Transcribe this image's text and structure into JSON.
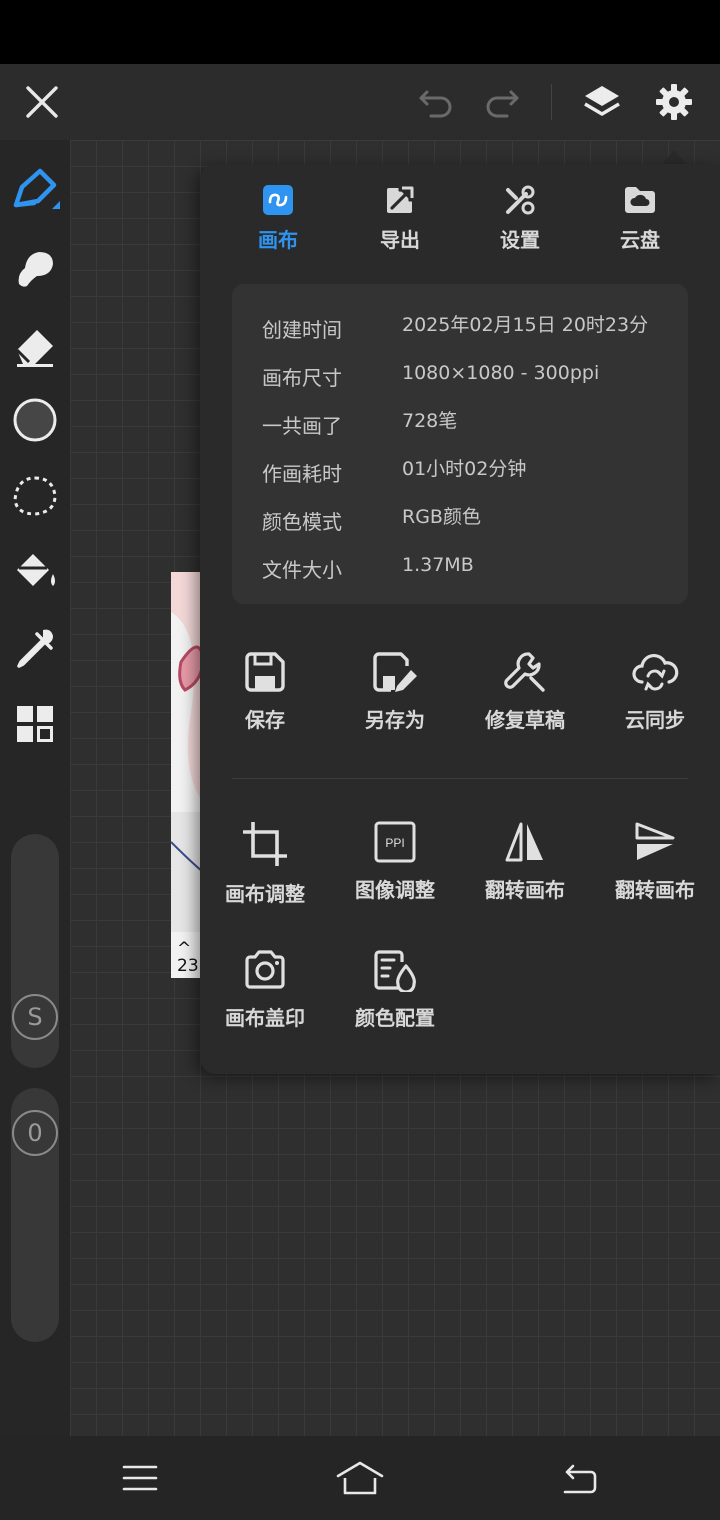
{
  "panel": {
    "tabs": [
      {
        "label": "画布",
        "icon": "canvas-icon",
        "active": true
      },
      {
        "label": "导出",
        "icon": "export-icon",
        "active": false
      },
      {
        "label": "设置",
        "icon": "settings-tools-icon",
        "active": false
      },
      {
        "label": "云盘",
        "icon": "cloud-drive-icon",
        "active": false
      }
    ],
    "info": [
      {
        "key": "创建时间",
        "value": "2025年02月15日 20时23分"
      },
      {
        "key": "画布尺寸",
        "value": "1080×1080 - 300ppi"
      },
      {
        "key": "一共画了",
        "value": "728笔"
      },
      {
        "key": "作画耗时",
        "value": "01小时02分钟"
      },
      {
        "key": "颜色模式",
        "value": "RGB颜色"
      },
      {
        "key": "文件大小",
        "value": "1.37MB"
      }
    ],
    "actions_row1": [
      {
        "label": "保存",
        "icon": "save-icon"
      },
      {
        "label": "另存为",
        "icon": "save-as-icon"
      },
      {
        "label": "修复草稿",
        "icon": "wrench-icon"
      },
      {
        "label": "云同步",
        "icon": "cloud-sync-icon"
      }
    ],
    "actions_row2": [
      {
        "label": "画布调整",
        "icon": "crop-icon"
      },
      {
        "label": "图像调整",
        "icon": "ppi-icon"
      },
      {
        "label": "翻转画布",
        "icon": "flip-horizontal-icon"
      },
      {
        "label": "翻转画布",
        "icon": "flip-vertical-icon"
      }
    ],
    "actions_row3": [
      {
        "label": "画布盖印",
        "icon": "camera-icon"
      },
      {
        "label": "颜色配置",
        "icon": "color-profile-icon"
      }
    ],
    "ppi_badge": "PPI"
  },
  "sliders": {
    "size_label": "S",
    "opacity_label": "0"
  },
  "canvas": {
    "art_caption_arrow": "^",
    "art_caption_number": "23"
  },
  "colors": {
    "accent": "#2f93f0",
    "panel_bg": "#2a2a2a",
    "info_bg": "#333333"
  }
}
